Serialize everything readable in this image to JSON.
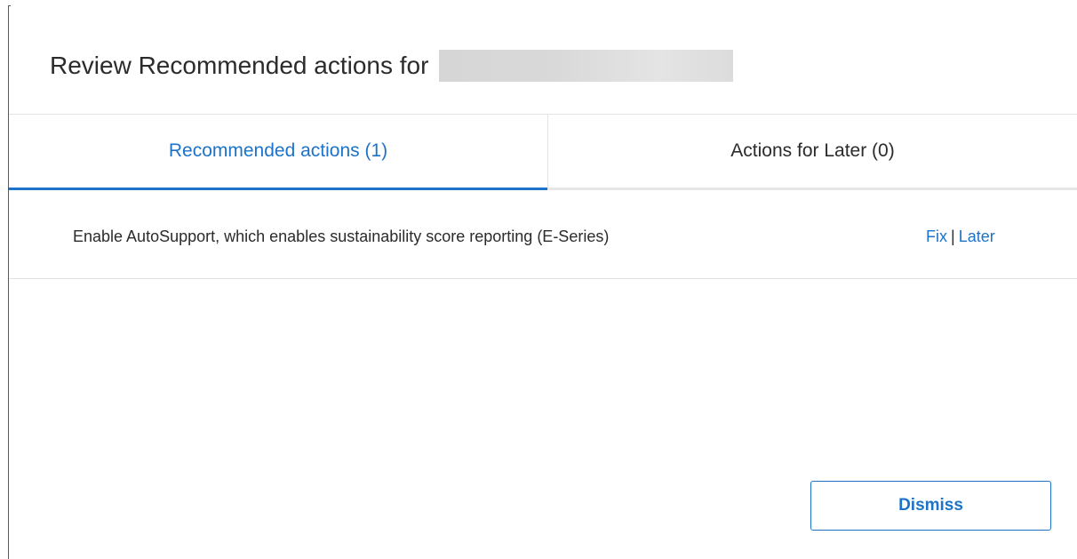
{
  "dialog": {
    "title": "Review Recommended actions for ",
    "title_target_redacted": true
  },
  "tabs": [
    {
      "label": "Recommended actions (1)",
      "active": true
    },
    {
      "label": "Actions for Later (0)",
      "active": false
    }
  ],
  "actions": [
    {
      "description": "Enable AutoSupport, which enables sustainability score reporting (E-Series)",
      "fix_label": "Fix",
      "separator": "|",
      "later_label": "Later"
    }
  ],
  "footer": {
    "dismiss_label": "Dismiss"
  },
  "colors": {
    "accent": "#1c73c9",
    "text": "#2b2b2b",
    "divider": "#e3e3e3"
  }
}
